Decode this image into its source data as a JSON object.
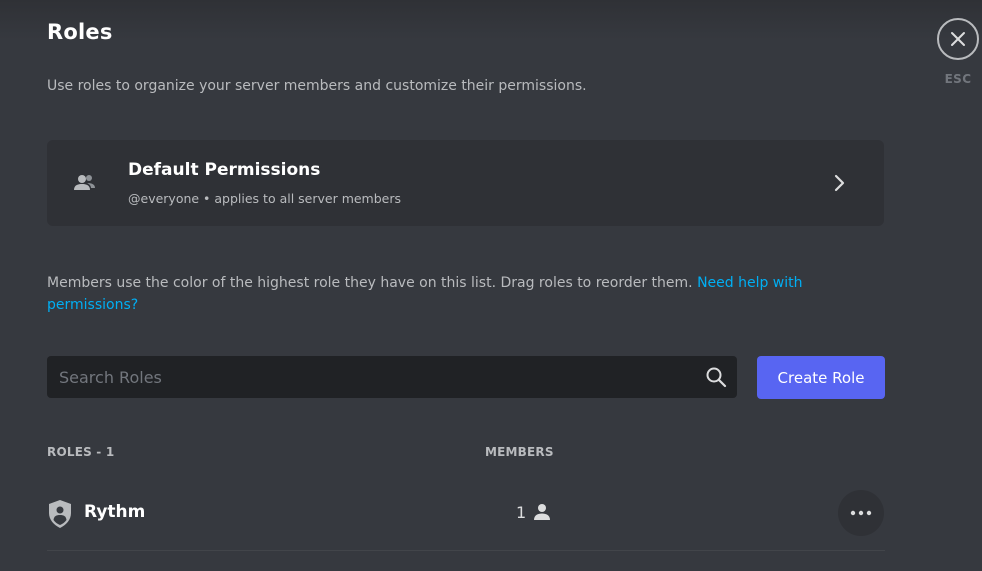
{
  "page": {
    "title": "Roles",
    "subtitle": "Use roles to organize your server members and customize their permissions."
  },
  "default_permissions": {
    "title": "Default Permissions",
    "subtitle": "@everyone • applies to all server members",
    "icon": "members-icon"
  },
  "info": {
    "text": "Members use the color of the highest role they have on this list. Drag roles to reorder them. ",
    "link_text": "Need help with permissions?"
  },
  "search": {
    "placeholder": "Search Roles",
    "value": ""
  },
  "create_role": {
    "label": "Create Role"
  },
  "table": {
    "roles_header": "ROLES - 1",
    "members_header": "MEMBERS",
    "rows": [
      {
        "name": "Rythm",
        "members": "1"
      }
    ]
  },
  "close": {
    "esc_label": "ESC"
  },
  "colors": {
    "accent": "#5865f2",
    "link": "#00aff4",
    "background": "#36393f",
    "card": "#2f3136",
    "input": "#202225"
  }
}
